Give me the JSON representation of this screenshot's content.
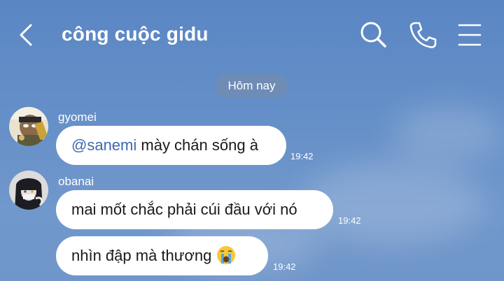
{
  "header": {
    "title": "công cuộc gidu",
    "back_icon": "chevron-left-icon",
    "search_icon": "search-icon",
    "call_icon": "phone-icon",
    "menu_icon": "menu-icon"
  },
  "date_separator": "Hôm nay",
  "messages": [
    {
      "sender": "gyomei",
      "avatar": "avatar-gyomei",
      "mention": "@sanemi",
      "text": " mày chán sống à",
      "time": "19:42"
    },
    {
      "sender": "obanai",
      "avatar": "avatar-obanai",
      "text": "mai mốt chắc phải cúi đầu với nó",
      "time": "19:42"
    },
    {
      "text": "nhìn đập mà thương",
      "emoji": "loudly-crying-face-icon",
      "time": "19:42"
    }
  ],
  "colors": {
    "background": "#6690c8",
    "bubble": "#ffffff",
    "mention": "#3f68b3",
    "date_pill": "#7f93ab"
  }
}
